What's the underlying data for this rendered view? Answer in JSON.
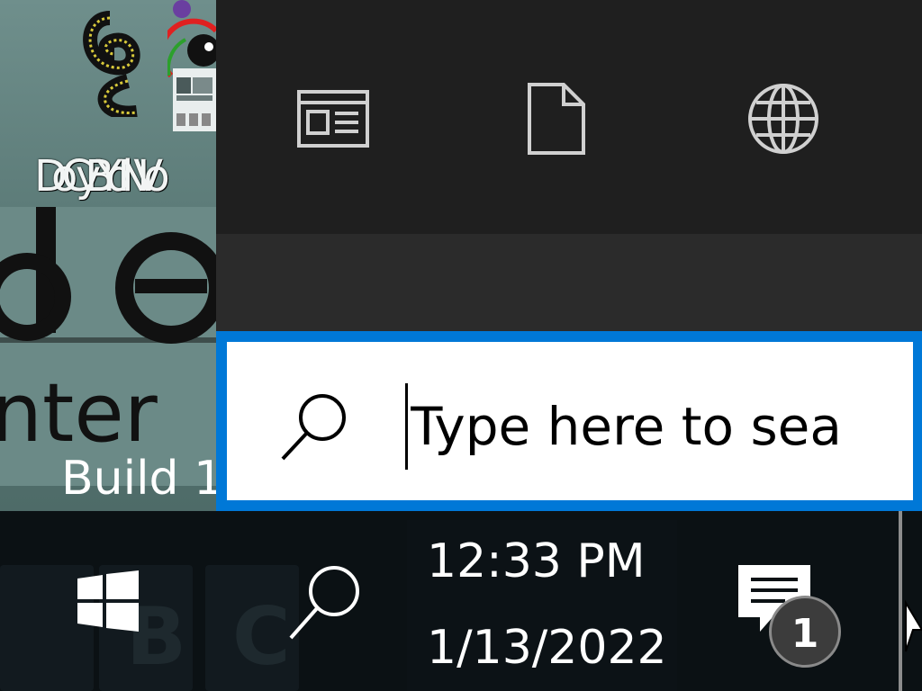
{
  "desktop": {
    "icon_label": "DoCyBYdNVo",
    "build_text": "Build 1"
  },
  "flyout": {
    "filters": [
      {
        "name": "apps",
        "icon": "news-window-icon"
      },
      {
        "name": "documents",
        "icon": "document-icon"
      },
      {
        "name": "web",
        "icon": "globe-icon"
      }
    ]
  },
  "search": {
    "placeholder": "Type here to sea",
    "icon": "search-icon"
  },
  "taskbar": {
    "start_icon": "windows-logo-icon",
    "search_icon": "search-icon",
    "clock": {
      "time": "12:33 PM",
      "date": "1/13/2022"
    },
    "notifications": {
      "icon": "action-center-icon",
      "count": "1"
    }
  },
  "colors": {
    "accent": "#0078d7",
    "flyout_bg": "#1f1f1f",
    "taskbar_bg": "#0b1114"
  }
}
